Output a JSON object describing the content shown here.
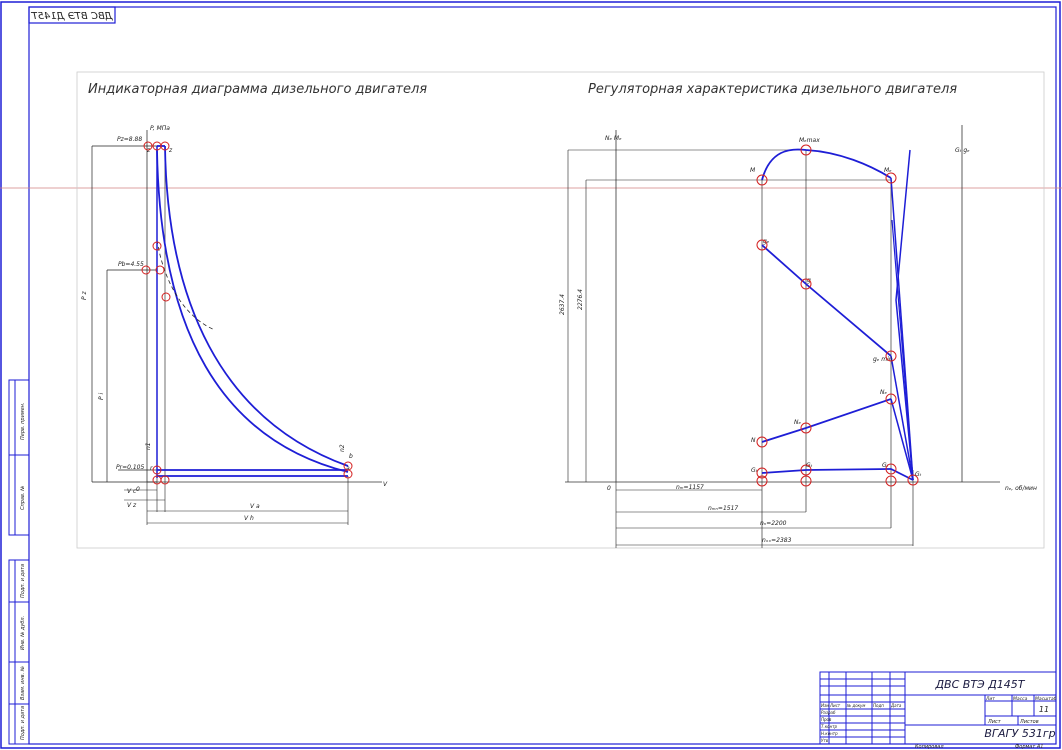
{
  "stamp": {
    "text": "ДВС ВТЭ Д145Т"
  },
  "left_panel": {
    "title": "Индикаторная диаграмма дизельного двигателя",
    "labels": {
      "pz": "Pz=8.88",
      "axis_p": "P, МПа",
      "z_left": "z",
      "z_right": "z",
      "pb": "Pb=4.55",
      "pr": "Pr=0.105",
      "rho_pz": "P z",
      "rho_pi": "P i",
      "v_axis": "V",
      "vc": "V c",
      "vz": "V z",
      "vh": "V h",
      "va": "V a",
      "zero": "0",
      "r": "r",
      "b": "b",
      "a": "a",
      "n1": "n1",
      "n2": "n2"
    }
  },
  "right_panel": {
    "title": "Регуляторная характеристика дизельного двигателя",
    "labels": {
      "axis_left": "Nₑ Mₑ",
      "axis_right": "Gₜ gₑ",
      "axis_x": "nₑ, об/мин",
      "zero": "0",
      "mmax": "Mₑmax",
      "mn": "M",
      "ne": "Mₑ",
      "gmax": "gₑ",
      "gmid": "g",
      "gmin": "gₑ min",
      "ge1": "N",
      "ge2": "Nₑ",
      "ge3": "Nₑ",
      "gt1": "Gₜ",
      "gt2": "Gₜ",
      "gt3": "Gₜ",
      "gt4": "Gₜ",
      "dim_y1": "2637.4",
      "dim_y2": "2276.4",
      "n_min": "nₘ=1157",
      "n_mid": "nₘₙ=1517",
      "n_nom": "nₙ=2200",
      "n_max": "nₓₓ=2383"
    }
  },
  "title_block": {
    "name": "ДВС ВТЭ Д145Т",
    "sheet": "11",
    "org": "ВГАГУ 531гр",
    "hdr_lit": "Лит",
    "hdr_mass": "Масса",
    "hdr_scale": "Масштаб",
    "hdr_sheet": "Лист",
    "hdr_sheets": "Листов",
    "rows": [
      "Изм",
      "Лист",
      "№ докум",
      "Подп",
      "Дата"
    ],
    "roles": [
      "Разраб",
      "Пров",
      "Т.контр",
      "Н.контр",
      "Утв"
    ],
    "copy": "Копировал",
    "format": "Формат А1"
  },
  "side_strip": {
    "cells": [
      "Перв. примен.",
      "Справ. №",
      "Подп. и дата",
      "Инв. № дубл.",
      "Взам. инв. №",
      "Подп. и дата",
      "Инв. № подл."
    ]
  }
}
